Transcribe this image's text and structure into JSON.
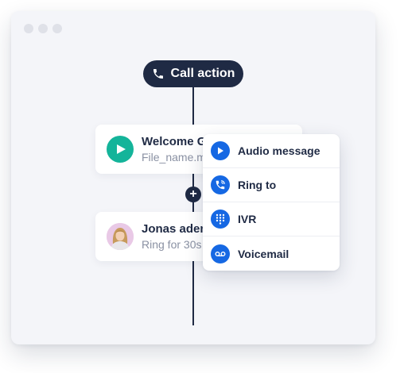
{
  "header": {
    "call_action_label": "Call action"
  },
  "cards": [
    {
      "title": "Welcome G",
      "subtitle": "File_name.m"
    },
    {
      "title": "Jonas aden",
      "subtitle": "Ring for 30s"
    }
  ],
  "add_button_label": "+",
  "menu": {
    "items": [
      {
        "label": "Audio message",
        "icon": "play-icon"
      },
      {
        "label": "Ring to",
        "icon": "phone-ring-icon"
      },
      {
        "label": "IVR",
        "icon": "keypad-icon"
      },
      {
        "label": "Voicemail",
        "icon": "voicemail-icon"
      }
    ]
  },
  "colors": {
    "navy": "#1f2a44",
    "teal": "#14b49a",
    "blue": "#1668e3",
    "muted": "#8a91a3"
  }
}
